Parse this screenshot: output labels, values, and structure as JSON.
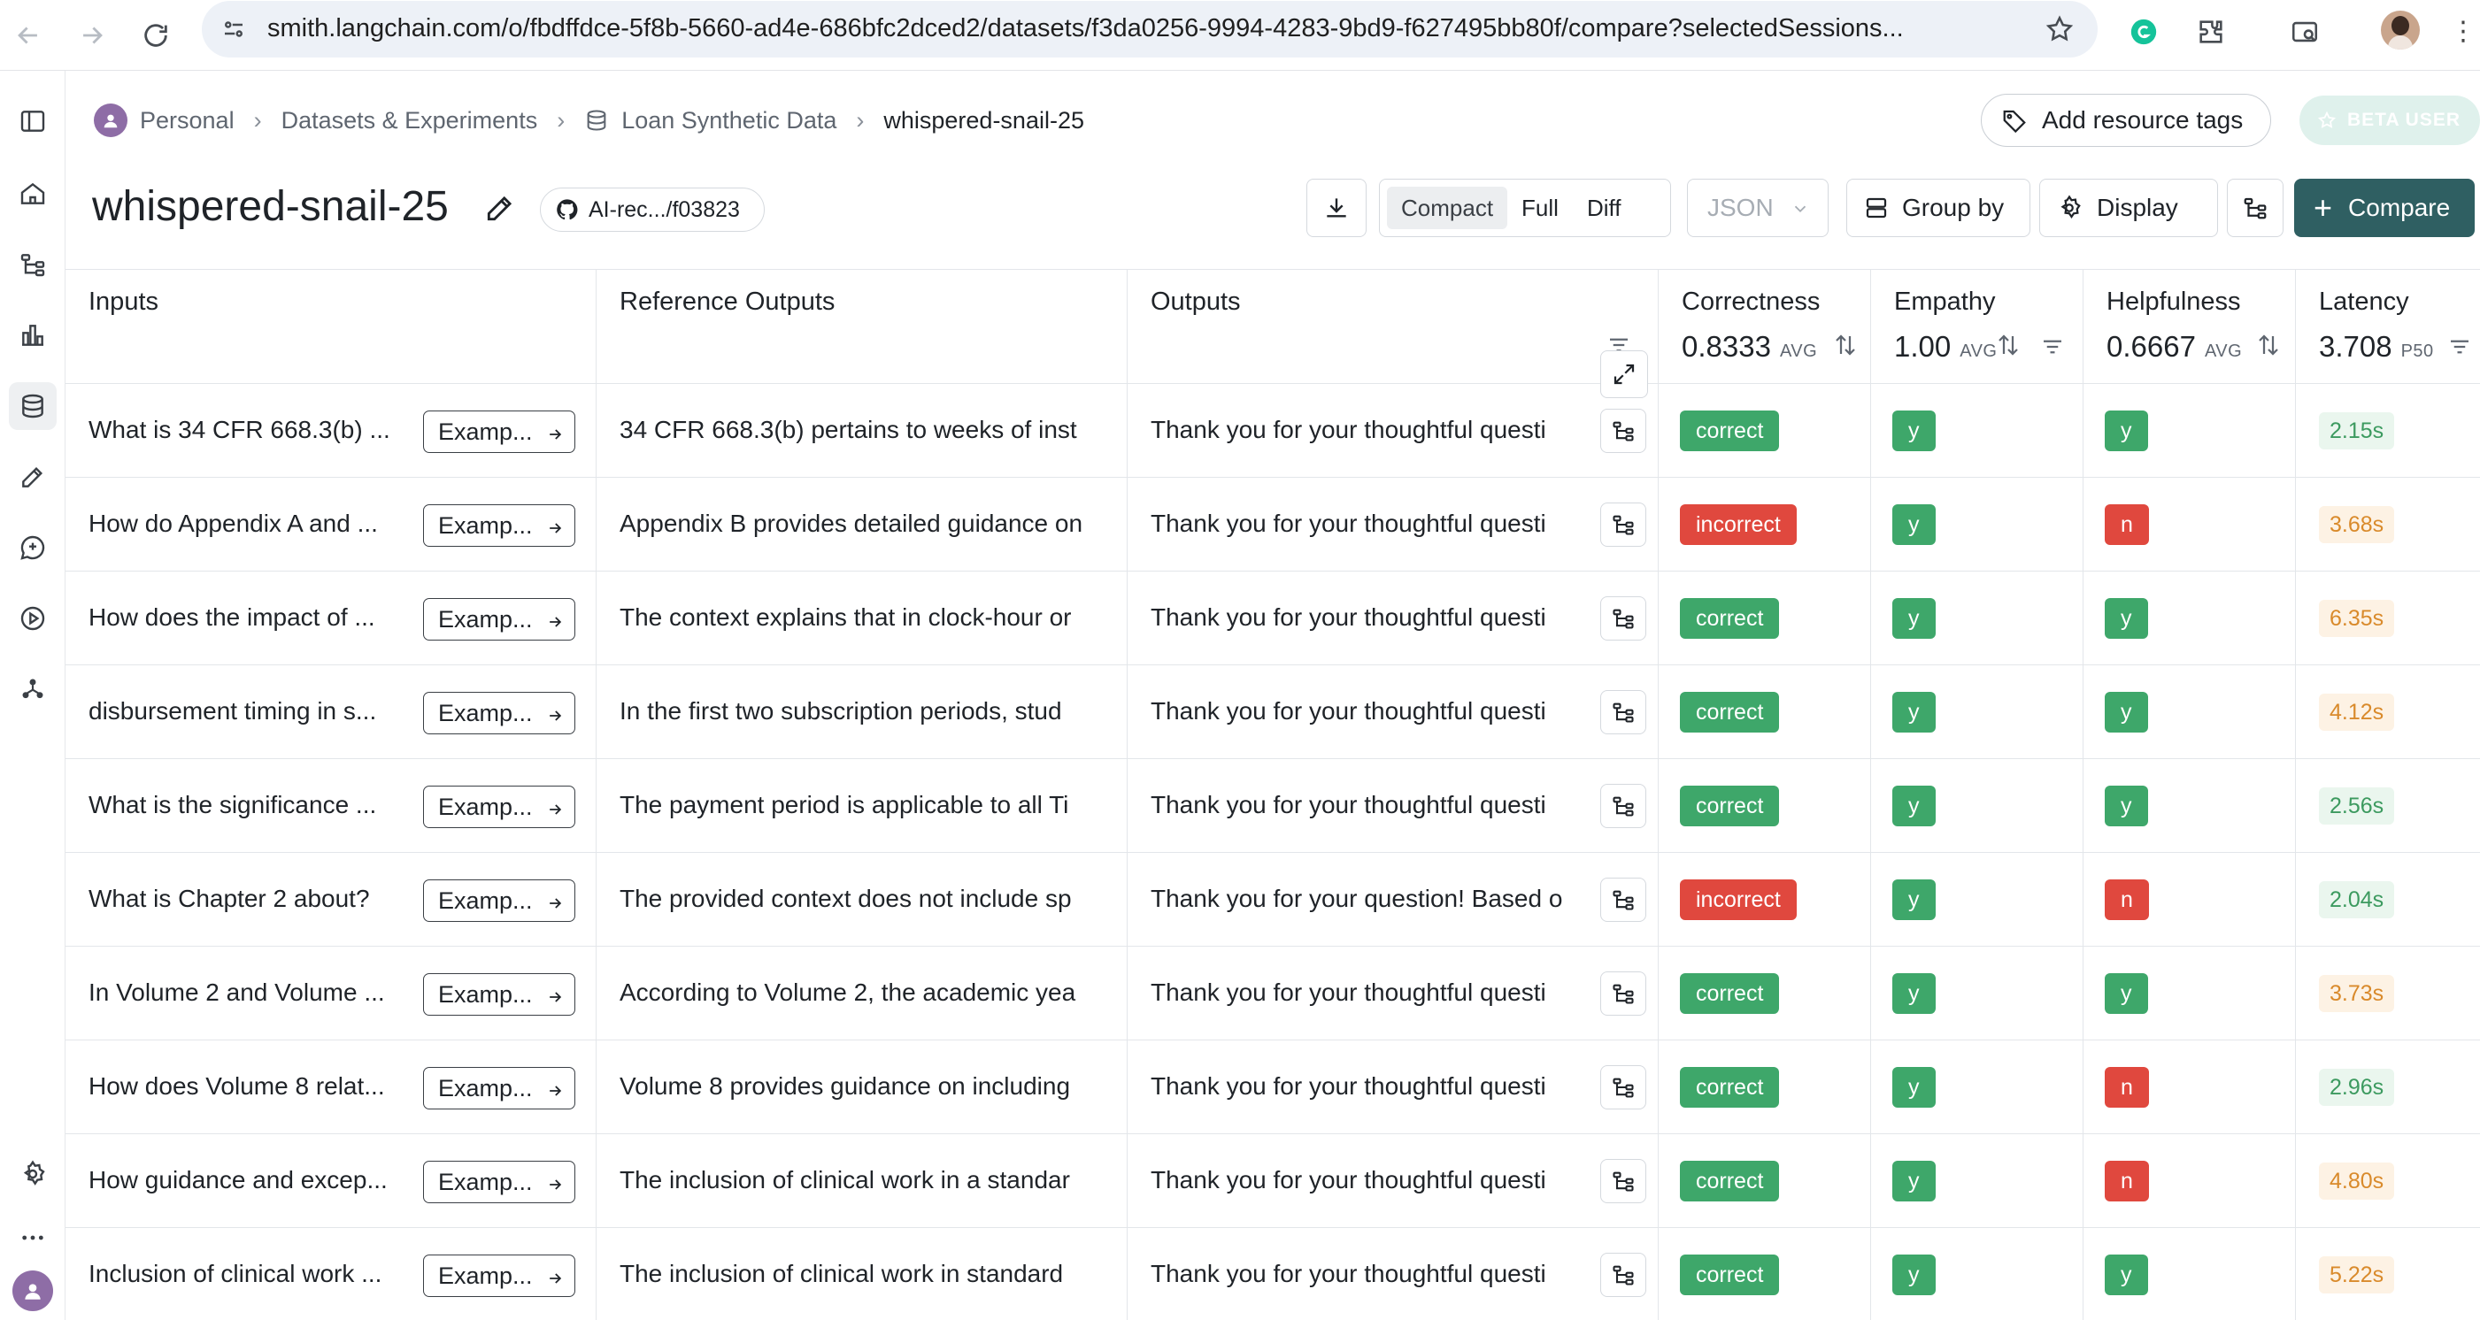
{
  "browser": {
    "url": "smith.langchain.com/o/fbdffdce-5f8b-5660-ad4e-686bfc2dced2/datasets/f3da0256-9994-4283-9bd9-f627495bb80f/compare?selectedSessions..."
  },
  "breadcrumb": {
    "items": [
      "Personal",
      "Datasets & Experiments",
      "Loan Synthetic Data",
      "whispered-snail-25"
    ]
  },
  "header": {
    "add_tags_label": "Add resource tags",
    "beta_label": "BETA USER",
    "title": "whispered-snail-25",
    "commit_label": "AI-rec.../f03823",
    "view_modes": [
      "Compact",
      "Full",
      "Diff"
    ],
    "active_view": "Compact",
    "format_select": "JSON",
    "group_by_label": "Group by",
    "display_label": "Display",
    "compare_label": "Compare"
  },
  "table": {
    "columns": {
      "inputs": "Inputs",
      "reference": "Reference Outputs",
      "outputs": "Outputs",
      "correctness": {
        "label": "Correctness",
        "value": "0.8333",
        "agg": "AVG"
      },
      "empathy": {
        "label": "Empathy",
        "value": "1.00",
        "agg": "AVG"
      },
      "helpfulness": {
        "label": "Helpfulness",
        "value": "0.6667",
        "agg": "AVG"
      },
      "latency": {
        "label": "Latency",
        "value": "3.708",
        "agg": "P50"
      }
    },
    "example_label": "Examp...",
    "rows": [
      {
        "input": "What is 34 CFR 668.3(b) ...",
        "reference": "34 CFR 668.3(b) pertains to weeks of inst",
        "output": "Thank you for your thoughtful questi",
        "correctness": "correct",
        "empathy": "y",
        "helpfulness": "y",
        "latency": "2.15s"
      },
      {
        "input": "How do Appendix A and ...",
        "reference": "Appendix B provides detailed guidance on",
        "output": "Thank you for your thoughtful questi",
        "correctness": "incorrect",
        "empathy": "y",
        "helpfulness": "n",
        "latency": "3.68s"
      },
      {
        "input": "How does the impact of ...",
        "reference": "The context explains that in clock-hour or",
        "output": "Thank you for your thoughtful questi",
        "correctness": "correct",
        "empathy": "y",
        "helpfulness": "y",
        "latency": "6.35s"
      },
      {
        "input": "disbursement timing in s...",
        "reference": "In the first two subscription periods, stud",
        "output": "Thank you for your thoughtful questi",
        "correctness": "correct",
        "empathy": "y",
        "helpfulness": "y",
        "latency": "4.12s"
      },
      {
        "input": "What is the significance ...",
        "reference": "The payment period is applicable to all Ti",
        "output": "Thank you for your thoughtful questi",
        "correctness": "correct",
        "empathy": "y",
        "helpfulness": "y",
        "latency": "2.56s"
      },
      {
        "input": "What is Chapter 2 about?",
        "reference": "The provided context does not include sp",
        "output": "Thank you for your question! Based o",
        "correctness": "incorrect",
        "empathy": "y",
        "helpfulness": "n",
        "latency": "2.04s"
      },
      {
        "input": "In Volume 2 and Volume ...",
        "reference": "According to Volume 2, the academic yea",
        "output": "Thank you for your thoughtful questi",
        "correctness": "correct",
        "empathy": "y",
        "helpfulness": "y",
        "latency": "3.73s"
      },
      {
        "input": "How does Volume 8 relat...",
        "reference": "Volume 8 provides guidance on including",
        "output": "Thank you for your thoughtful questi",
        "correctness": "correct",
        "empathy": "y",
        "helpfulness": "n",
        "latency": "2.96s"
      },
      {
        "input": "How guidance and excep...",
        "reference": "The inclusion of clinical work in a standar",
        "output": "Thank you for your thoughtful questi",
        "correctness": "correct",
        "empathy": "y",
        "helpfulness": "n",
        "latency": "4.80s"
      },
      {
        "input": "Inclusion of clinical work ...",
        "reference": "The inclusion of clinical work in standard",
        "output": "Thank you for your thoughtful questi",
        "correctness": "correct",
        "empathy": "y",
        "helpfulness": "y",
        "latency": "5.22s"
      }
    ]
  },
  "colors": {
    "accent": "#2f5f62",
    "pass": "#3ea76a",
    "fail": "#e0483e",
    "latency_good": "#3c9a5f",
    "latency_warn": "#d98a2b"
  }
}
